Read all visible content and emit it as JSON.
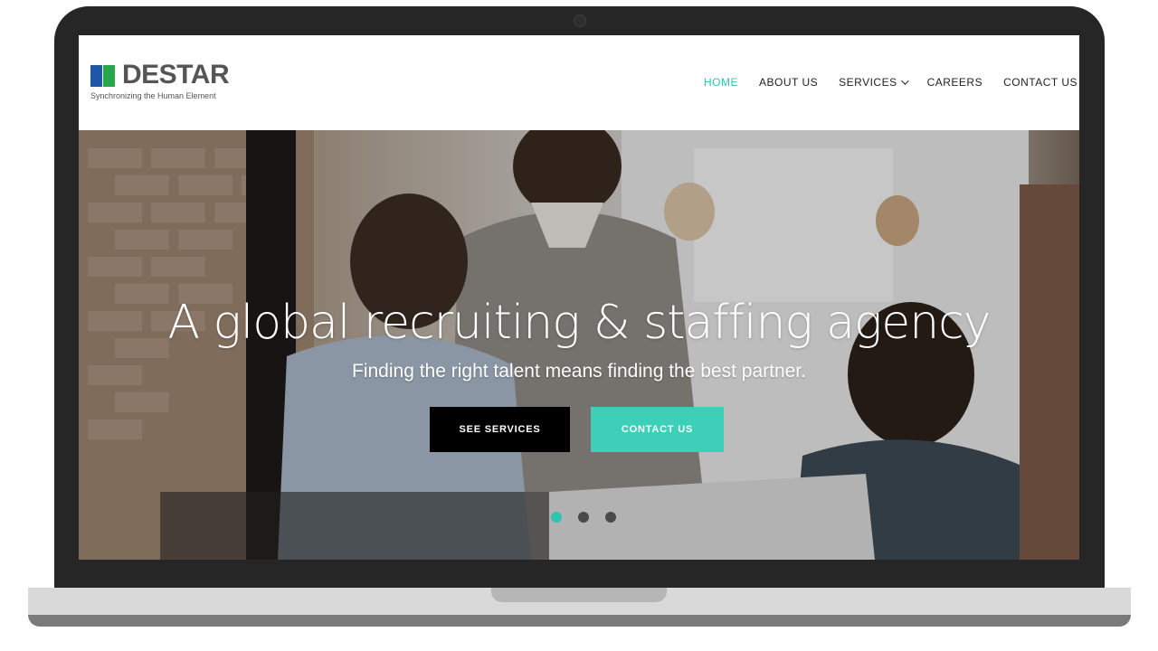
{
  "logo": {
    "name": "DESTAR",
    "tagline": "Synchronizing the Human Element"
  },
  "nav": {
    "items": [
      {
        "label": "HOME",
        "active": true
      },
      {
        "label": "ABOUT US",
        "active": false
      },
      {
        "label": "SERVICES",
        "active": false,
        "dropdown": true
      },
      {
        "label": "CAREERS",
        "active": false
      },
      {
        "label": "CONTACT US",
        "active": false
      }
    ]
  },
  "hero": {
    "title": "A global recruiting & staffing agency",
    "subtitle": "Finding the right talent means finding the best partner.",
    "primary_button": "SEE SERVICES",
    "secondary_button": "CONTACT US",
    "slides": 3,
    "active_slide": 1
  },
  "colors": {
    "accent": "#2ec4b0",
    "button_dark": "#000000",
    "button_accent": "#3ecfb8",
    "logo_blue": "#1f57a8",
    "logo_green": "#28a64a",
    "bezel": "#262626"
  },
  "icons": [
    "chevron-down-icon"
  ]
}
